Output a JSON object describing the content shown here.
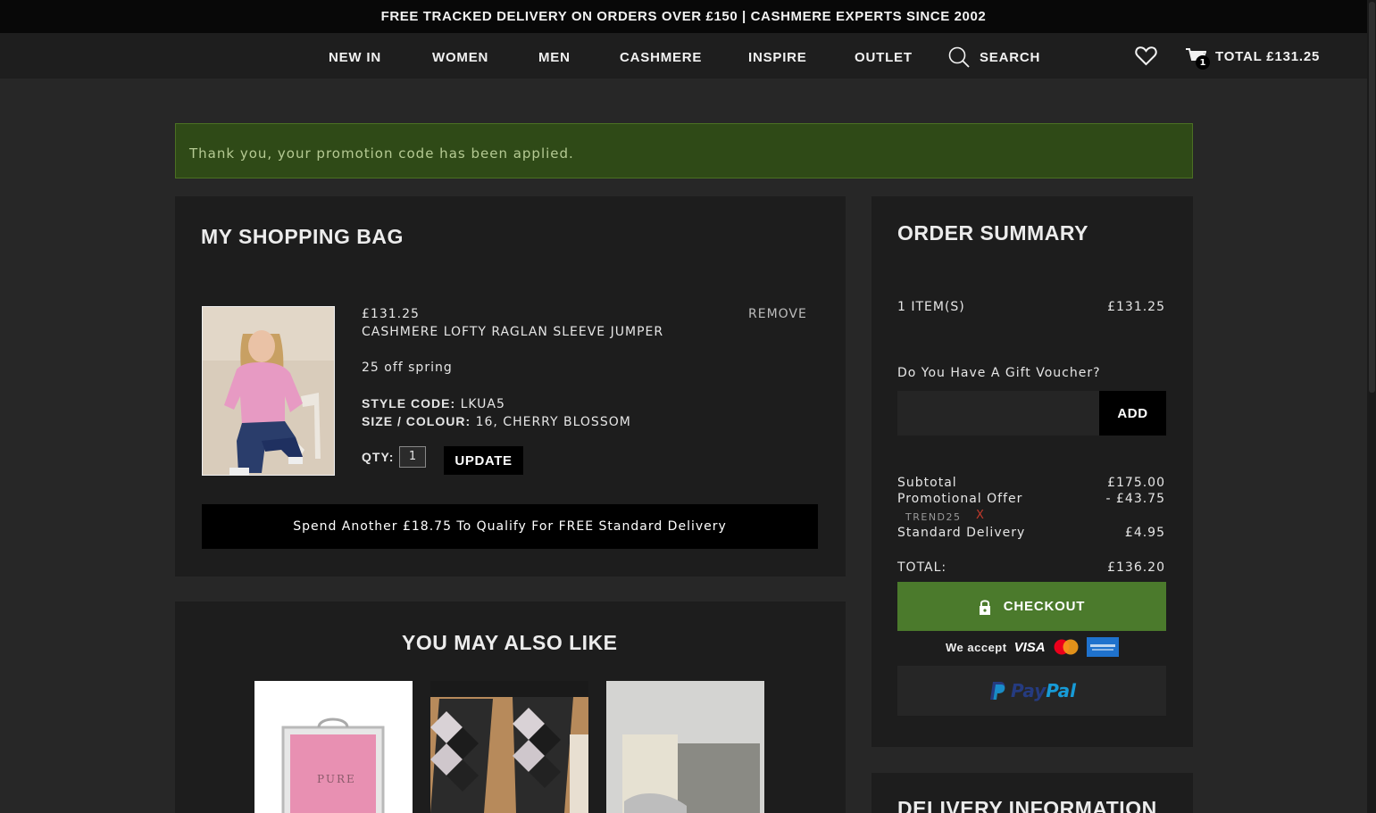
{
  "announcement": "FREE TRACKED DELIVERY ON ORDERS OVER £150 | CASHMERE EXPERTS SINCE 2002",
  "nav": {
    "items": [
      "NEW IN",
      "WOMEN",
      "MEN",
      "CASHMERE",
      "INSPIRE",
      "OUTLET"
    ],
    "search_label": "SEARCH",
    "cart_count": "1",
    "cart_total": "TOTAL £131.25"
  },
  "promo_message": "Thank you, your promotion code has been applied.",
  "bag": {
    "title": "MY SHOPPING BAG",
    "item": {
      "price": "£131.25",
      "name": "CASHMERE LOFTY RAGLAN SLEEVE JUMPER",
      "promo": "25 off spring",
      "style_code_label": "STYLE CODE:",
      "style_code": "LKUA5",
      "size_colour_label": "SIZE / COLOUR:",
      "size_colour": "16, CHERRY BLOSSOM",
      "qty_label": "QTY:",
      "qty": "1",
      "update_label": "UPDATE",
      "remove_label": "REMOVE"
    },
    "delivery_message": "Spend Another £18.75 To Qualify For FREE Standard Delivery"
  },
  "recommendations": {
    "title": "YOU MAY ALSO LIKE",
    "product1_logo": "PURE"
  },
  "summary": {
    "title": "ORDER SUMMARY",
    "items_label": "1 ITEM(S)",
    "items_value": "£131.25",
    "voucher_label": "Do You Have A Gift Voucher?",
    "voucher_button": "ADD",
    "subtotal_label": "Subtotal",
    "subtotal_value": "£175.00",
    "promo_label": "Promotional Offer",
    "promo_value": "- £43.75",
    "promo_code": "TREND25",
    "promo_remove": "X",
    "delivery_label": "Standard Delivery",
    "delivery_value": "£4.95",
    "total_label": "TOTAL:",
    "total_value": "£136.20",
    "checkout_label": "CHECKOUT",
    "we_accept": "We accept",
    "visa": "VISA",
    "paypal_pay": "Pay",
    "paypal_pal": "Pal"
  },
  "delivery_info_title": "DELIVERY INFORMATION",
  "colors": {
    "accent_green": "#4b7a2c",
    "promo_bg": "#2f4a17",
    "remove_x": "#c0392b"
  }
}
